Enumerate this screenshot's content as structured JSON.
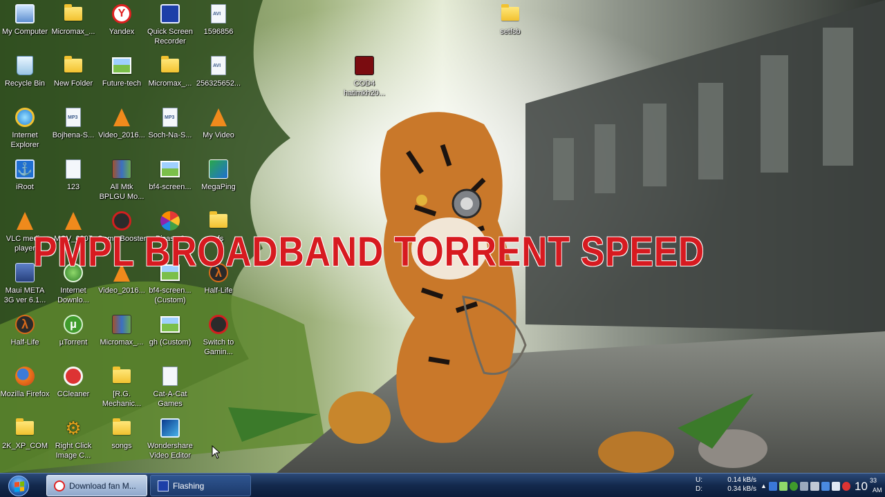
{
  "overlay_title": "PMPL BROADBAND TORRENT SPEED",
  "desktop_icons": [
    {
      "label": "My Computer",
      "icon": "computer-icon"
    },
    {
      "label": "Micromax_...",
      "icon": "folder-icon"
    },
    {
      "label": "Yandex",
      "icon": "yandex-icon"
    },
    {
      "label": "Quick Screen Recorder",
      "icon": "screen-recorder-icon"
    },
    {
      "label": "1596856",
      "icon": "video-file-icon"
    },
    {
      "label": "setfsb",
      "icon": "folder-icon"
    },
    {
      "label": "Recycle Bin",
      "icon": "recycle-bin-icon"
    },
    {
      "label": "New Folder",
      "icon": "folder-icon"
    },
    {
      "label": "Future-tech",
      "icon": "image-icon"
    },
    {
      "label": "Micromax_...",
      "icon": "folder-icon"
    },
    {
      "label": "256325652...",
      "icon": "video-file-icon"
    },
    {
      "label": "COD4 hatimkh20...",
      "icon": "cod4-icon"
    },
    {
      "label": "Internet Explorer",
      "icon": "internet-explorer-icon"
    },
    {
      "label": "Bojhena-S...",
      "icon": "mp3-file-icon"
    },
    {
      "label": "Video_2016...",
      "icon": "vlc-file-icon"
    },
    {
      "label": "Soch-Na-S...",
      "icon": "mp3-file-icon"
    },
    {
      "label": "My Video",
      "icon": "vlc-file-icon"
    },
    {
      "label": "iRoot",
      "icon": "iroot-icon"
    },
    {
      "label": "123",
      "icon": "document-icon"
    },
    {
      "label": "All Mtk BPLGU Mo...",
      "icon": "archive-icon"
    },
    {
      "label": "bf4-screen...",
      "icon": "image-icon"
    },
    {
      "label": "MegaPing",
      "icon": "megaping-icon"
    },
    {
      "label": "VLC media player",
      "icon": "vlc-icon"
    },
    {
      "label": "MOV_0007",
      "icon": "vlc-file-icon"
    },
    {
      "label": "Game Booster",
      "icon": "game-booster-icon"
    },
    {
      "label": "Picasa 3",
      "icon": "picasa-icon"
    },
    {
      "label": "nfs",
      "icon": "folder-icon"
    },
    {
      "label": "Maui META 3G ver 6.1...",
      "icon": "maui-meta-icon"
    },
    {
      "label": "Internet Downlo...",
      "icon": "idm-icon"
    },
    {
      "label": "Video_2016...",
      "icon": "vlc-file-icon"
    },
    {
      "label": "bf4-screen... (Custom)",
      "icon": "image-icon"
    },
    {
      "label": "Half-Life",
      "icon": "half-life-icon"
    },
    {
      "label": "Half-Life",
      "icon": "half-life-icon"
    },
    {
      "label": "µTorrent",
      "icon": "utorrent-icon"
    },
    {
      "label": "Micromax_...",
      "icon": "archive-icon"
    },
    {
      "label": "gh (Custom)",
      "icon": "image-icon"
    },
    {
      "label": "Switch to Gamin...",
      "icon": "game-booster-icon"
    },
    {
      "label": "Mozilla Firefox",
      "icon": "firefox-icon"
    },
    {
      "label": "CCleaner",
      "icon": "ccleaner-icon"
    },
    {
      "label": "[R.G. Mechanic...",
      "icon": "folder-icon"
    },
    {
      "label": "Cat-A-Cat Games",
      "icon": "document-icon"
    },
    {
      "label": "2K_XP_COM",
      "icon": "folder-icon"
    },
    {
      "label": "Right Click Image C...",
      "icon": "gear-icon"
    },
    {
      "label": "songs",
      "icon": "folder-icon"
    },
    {
      "label": "Wondershare Video Editor",
      "icon": "video-editor-icon"
    }
  ],
  "taskbar": {
    "buttons": [
      {
        "label": "Download fan M...",
        "icon": "yandex-icon",
        "state": "active"
      },
      {
        "label": "Flashing",
        "icon": "screen-recorder-icon",
        "state": "inactive"
      }
    ],
    "net_speed": {
      "upload_label": "U:",
      "upload_value": "0.14 kB/s",
      "download_label": "D:",
      "download_value": "0.34 kB/s"
    },
    "clock": {
      "hour_big": "10",
      "minute": "33",
      "ampm": "AM"
    }
  },
  "colors": {
    "title_red": "#d71a20",
    "taskbar_blue": "#13294d"
  }
}
